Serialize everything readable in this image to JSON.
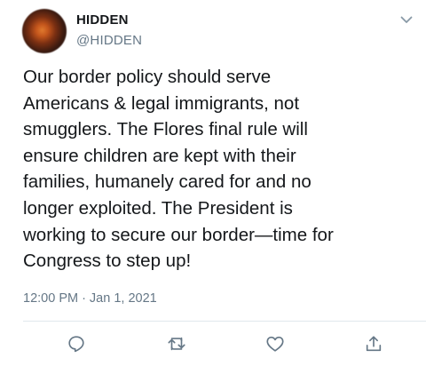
{
  "author": {
    "name": "HIDDEN",
    "handle": "@HIDDEN"
  },
  "tweet": {
    "text": "Our border policy should serve\nAmericans & legal immigrants, not\nsmugglers. The Flores final rule will\nensure children are kept with their\nfamilies, humanely cared for and no\nlonger exploited. The President is\nworking to secure our border—time for\nCongress to step up!",
    "time": "12:00 PM",
    "separator": "·",
    "date": "Jan 1, 2021"
  },
  "icons": {
    "menu": "chevron-down-icon",
    "reply": "reply-icon",
    "retweet": "retweet-icon",
    "like": "like-icon",
    "share": "share-icon"
  },
  "colors": {
    "icon": "#657786",
    "text": "#14171a",
    "secondary": "#657786"
  }
}
